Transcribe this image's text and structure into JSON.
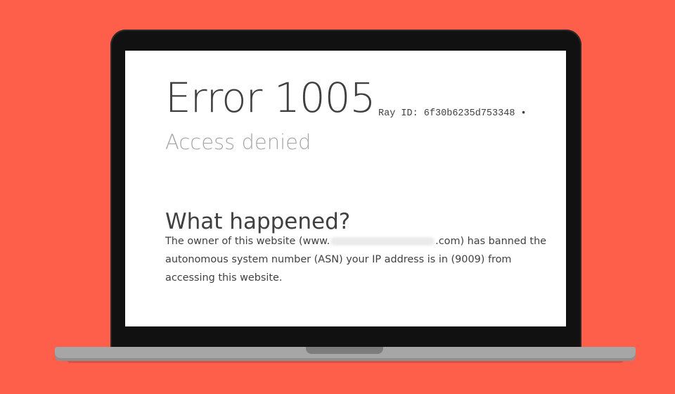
{
  "error": {
    "title": "Error 1005",
    "ray_id": "Ray ID: 6f30b6235d753348 •",
    "subtitle": "Access denied"
  },
  "what_happened": {
    "heading": "What happened?",
    "line1_before": "The owner of this website (www.",
    "line1_after": ".com) has banned the",
    "line2": "autonomous system number (ASN) your IP address is in (9009) from",
    "line3": "accessing this website."
  },
  "colors": {
    "background": "#fd5f4b",
    "bezel": "#111111",
    "screen": "#ffffff",
    "text": "#404040",
    "muted_text": "#a6a6a6"
  }
}
